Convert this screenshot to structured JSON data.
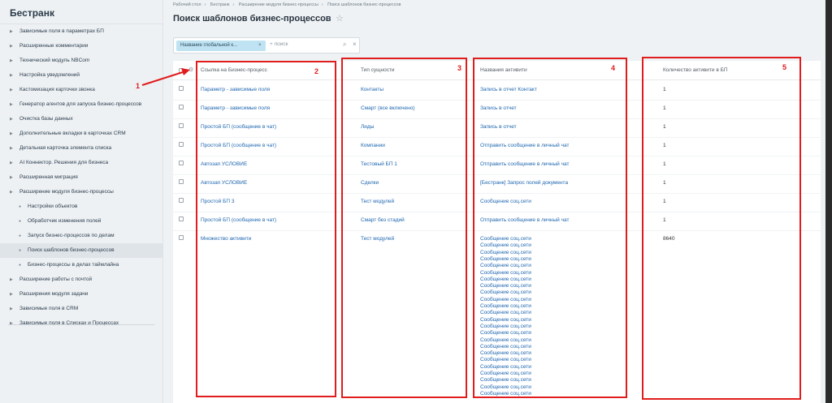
{
  "sidebar": {
    "brand": "Бестранк",
    "items": [
      {
        "label": "Зависимые поля в параметрах БП",
        "sub": false
      },
      {
        "label": "Расширенные комментарии",
        "sub": false
      },
      {
        "label": "Технический модуль NBCom",
        "sub": false
      },
      {
        "label": "Настройка уведомлений",
        "sub": false
      },
      {
        "label": "Кастомизация карточки звонка",
        "sub": false
      },
      {
        "label": "Генератор агентов для запуска бизнес-процессов",
        "sub": false
      },
      {
        "label": "Очистка базы данных",
        "sub": false
      },
      {
        "label": "Дополнительные вкладки в карточках CRM",
        "sub": false
      },
      {
        "label": "Детальная карточка элемента списка",
        "sub": false
      },
      {
        "label": "AI Коннектор. Решения для бизнеса",
        "sub": false
      },
      {
        "label": "Расширенная миграция",
        "sub": false
      },
      {
        "label": "Расширение модуля бизнес-процессы",
        "sub": false
      },
      {
        "label": "Настройки объектов",
        "sub": true
      },
      {
        "label": "Обработчик изменения полей",
        "sub": true
      },
      {
        "label": "Запуск бизнес-процессов по делам",
        "sub": true
      },
      {
        "label": "Поиск шаблонов бизнес-процессов",
        "sub": true,
        "active": true
      },
      {
        "label": "Бизнес-процессы в делах таймлайна",
        "sub": true
      },
      {
        "label": "Расширение работы с почтой",
        "sub": false
      },
      {
        "label": "Расширения модуля задачи",
        "sub": false
      },
      {
        "label": "Зависимые поля в CRM",
        "sub": false
      },
      {
        "label": "Зависимые поля в Списках и Процессах",
        "sub": false
      }
    ]
  },
  "breadcrumb": [
    "Рабочий стол",
    "Бестранк",
    "Расширение модуля бизнес-процессы",
    "Поиск шаблонов бизнес-процессов"
  ],
  "page_title": "Поиск шаблонов бизнес-процессов",
  "filter": {
    "chip_label": "Название глобальной к...",
    "placeholder": "+ поиск"
  },
  "table": {
    "headers": [
      "Ссылка на Бизнес-процесс",
      "Тип сущности",
      "Названия активити",
      "Количество активити в БП"
    ],
    "rows": [
      {
        "link": "Параметр - зависимые поля",
        "type": "Контакты",
        "activity": "Запись в отчет Контакт",
        "count": "1"
      },
      {
        "link": "Параметр - зависимые поля",
        "type": "Смарт (все включено)",
        "activity": "Запись в отчет",
        "count": "1"
      },
      {
        "link": "Простой БП (сообщение в чат)",
        "type": "Лиды",
        "activity": "Запись в отчет",
        "count": "1"
      },
      {
        "link": "Простой БП (сообщение в чат)",
        "type": "Компании",
        "activity": "Отправить сообщение в личный чат",
        "count": "1"
      },
      {
        "link": "Автозап УСЛОВИЕ",
        "type": "Тестовый БП 1",
        "activity": "Отправить сообщение в личный чат",
        "count": "1"
      },
      {
        "link": "Автозап УСЛОВИЕ",
        "type": "Сделки",
        "activity": "[Бестранк] Запрос полей документа",
        "count": "1"
      },
      {
        "link": "Простой БП 3",
        "type": "Тест модулей",
        "activity": "Сообщение соц.сети",
        "count": "1"
      },
      {
        "link": "Простой БП (сообщение в чат)",
        "type": "Смарт без стадий",
        "activity": "Отправить сообщение в личный чат",
        "count": "1"
      },
      {
        "link": "Множество активити",
        "type": "Тест модулей",
        "activity": "Сообщение соц.сети",
        "count": "8640"
      }
    ],
    "repeated_activity": "Сообщение соц.сети"
  },
  "annotations": [
    "1",
    "2",
    "3",
    "4",
    "5"
  ],
  "colors": {
    "annotation_red": "#e11c1c",
    "link_blue": "#2067b0"
  }
}
